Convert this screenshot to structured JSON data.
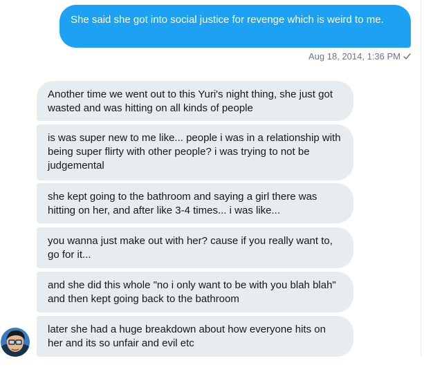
{
  "conversation": {
    "sent_message": {
      "text": "She said she got into social justice for revenge which is weird to me.",
      "timestamp": "Aug 18, 2014, 1:36 PM",
      "status_icon": "checkmark-icon"
    },
    "received_messages": [
      {
        "text": "Another time we went out to this Yuri's night thing, she just got wasted and was hitting on all kinds of people"
      },
      {
        "text": "is was super new to me like... people i was in a relationship with being super flirty with other people? i was trying to not be judgemental"
      },
      {
        "text": "she kept going to the bathroom and saying a girl there was hitting on her, and after like 3-4 times... i was like..."
      },
      {
        "text": "you wanna just make out with her? cause if you really want to, go for it..."
      },
      {
        "text": "and she did this whole \"no i only want to be with you blah blah\" and then kept going back to the bathroom"
      },
      {
        "text": "later she had a huge breakdown about how everyone hits on her and its so unfair and evil etc"
      }
    ]
  },
  "colors": {
    "sent_bubble": "#1da1f2",
    "received_bubble": "#e6ecf0",
    "meta_text": "#657786",
    "message_text": "#14171a"
  },
  "icons": {
    "avatar": "cartoon-avatar-icon",
    "delivered": "checkmark-icon"
  }
}
